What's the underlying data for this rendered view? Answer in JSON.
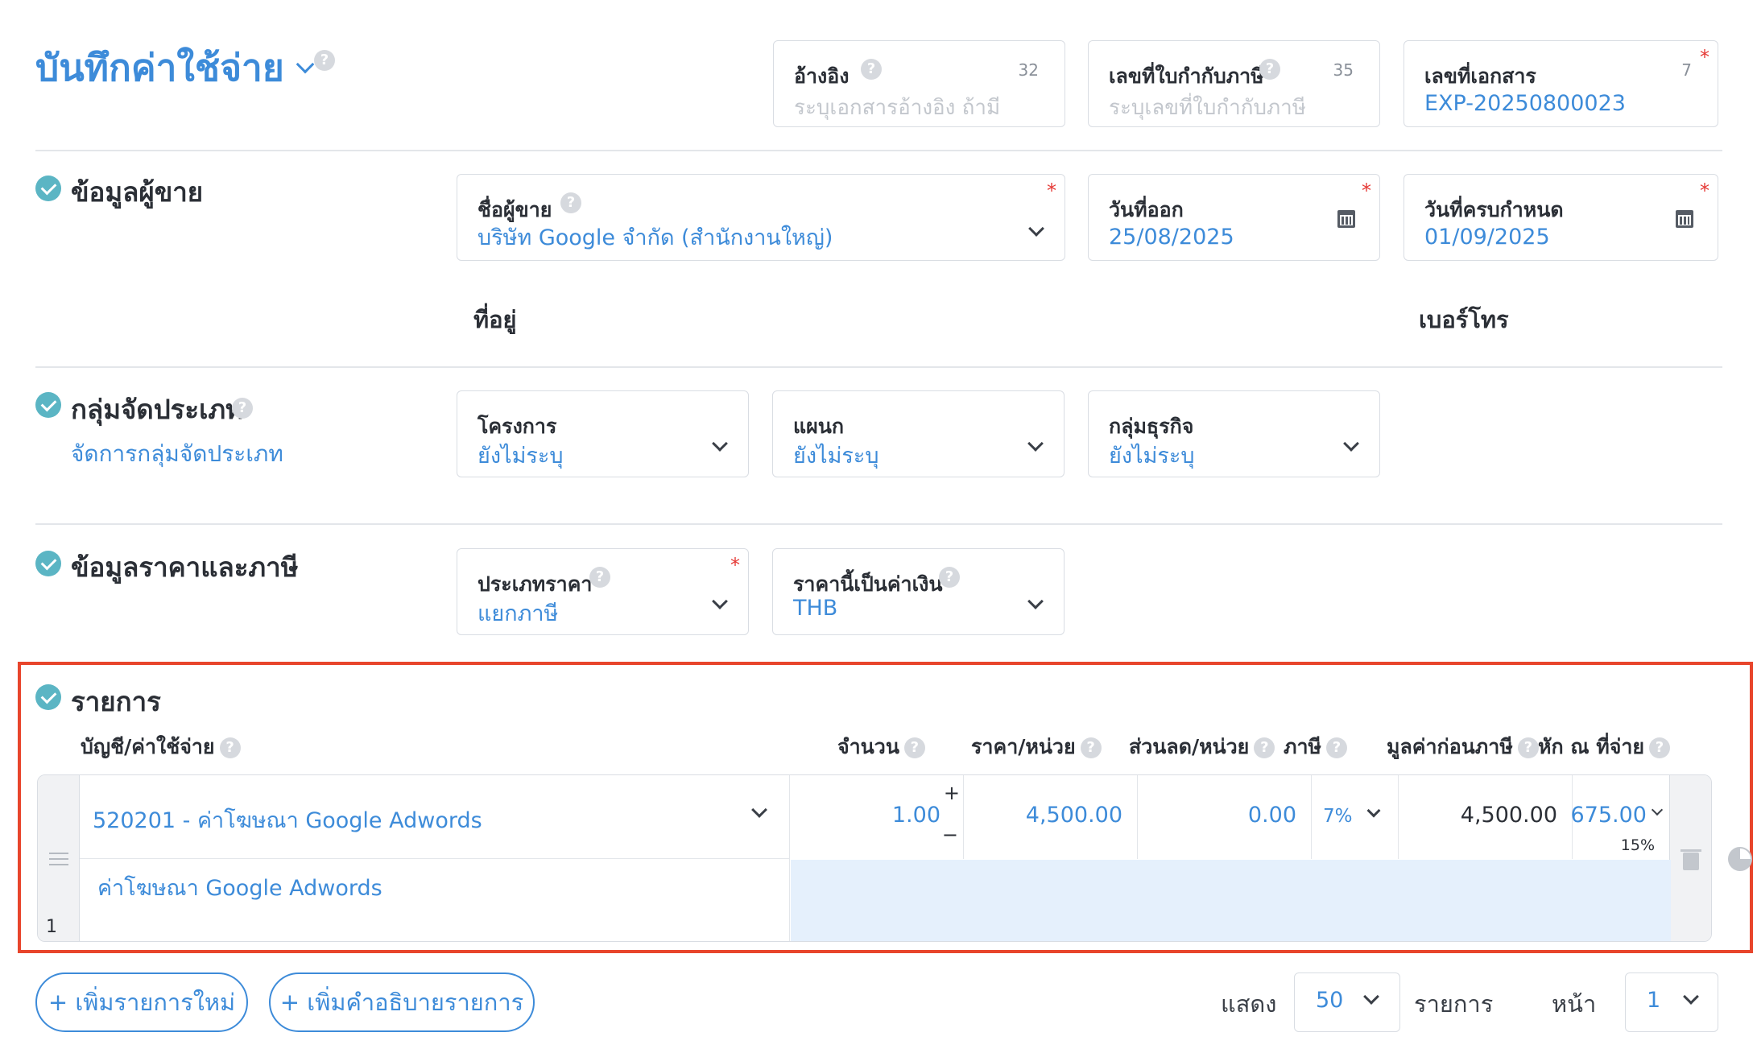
{
  "header": {
    "title": "บันทึกค่าใช้จ่าย",
    "fields": {
      "reference": {
        "label": "อ้างอิง",
        "count": "32",
        "placeholder": "ระบุเอกสารอ้างอิง ถ้ามี"
      },
      "tax_invoice": {
        "label": "เลขที่ใบกำกับภาษี",
        "count": "35",
        "placeholder": "ระบุเลขที่ใบกำกับภาษี"
      },
      "document_no": {
        "label": "เลขที่เอกสาร",
        "count": "7",
        "value": "EXP-20250800023"
      }
    }
  },
  "vendor_section": {
    "title": "ข้อมูลผู้ขาย",
    "vendor_name": {
      "label": "ชื่อผู้ขาย",
      "value": "บริษัท Google จำกัด (สำนักงานใหญ่)"
    },
    "issue_date": {
      "label": "วันที่ออก",
      "value": "25/08/2025"
    },
    "due_date": {
      "label": "วันที่ครบกำหนด",
      "value": "01/09/2025"
    },
    "address_label": "ที่อยู่",
    "phone_label": "เบอร์โทร"
  },
  "category_section": {
    "title": "กลุ่มจัดประเภท",
    "manage_link": "จัดการกลุ่มจัดประเภท",
    "project": {
      "label": "โครงการ",
      "value": "ยังไม่ระบุ"
    },
    "department": {
      "label": "แผนก",
      "value": "ยังไม่ระบุ"
    },
    "business_group": {
      "label": "กลุ่มธุรกิจ",
      "value": "ยังไม่ระบุ"
    }
  },
  "price_section": {
    "title": "ข้อมูลราคาและภาษี",
    "price_type": {
      "label": "ประเภทราคา",
      "value": "แยกภาษี"
    },
    "currency": {
      "label": "ราคานี้เป็นค่าเงิน",
      "value": "THB"
    }
  },
  "items_section": {
    "title": "รายการ",
    "columns": {
      "account": "บัญชี/ค่าใช้จ่าย",
      "quantity": "จำนวน",
      "unit_price": "ราคา/หน่วย",
      "discount": "ส่วนลด/หน่วย",
      "tax": "ภาษี",
      "pre_tax": "มูลค่าก่อนภาษี",
      "withholding": "หัก ณ ที่จ่าย"
    },
    "rows": [
      {
        "index": "1",
        "account": "520201 - ค่าโฆษณา Google Adwords",
        "description": "ค่าโฆษณา Google Adwords",
        "quantity": "1.00",
        "unit_price": "4,500.00",
        "discount": "0.00",
        "tax": "7%",
        "pre_tax": "4,500.00",
        "withholding": "675.00",
        "withholding_rate": "15%"
      }
    ],
    "highlight_color": "#e8452c"
  },
  "footer": {
    "add_item": "+ เพิ่มรายการใหม่",
    "add_description": "+ เพิ่มคำอธิบายรายการ",
    "show_label": "แสดง",
    "per_page": "50",
    "items_label": "รายการ",
    "page_label": "หน้า",
    "page": "1"
  }
}
